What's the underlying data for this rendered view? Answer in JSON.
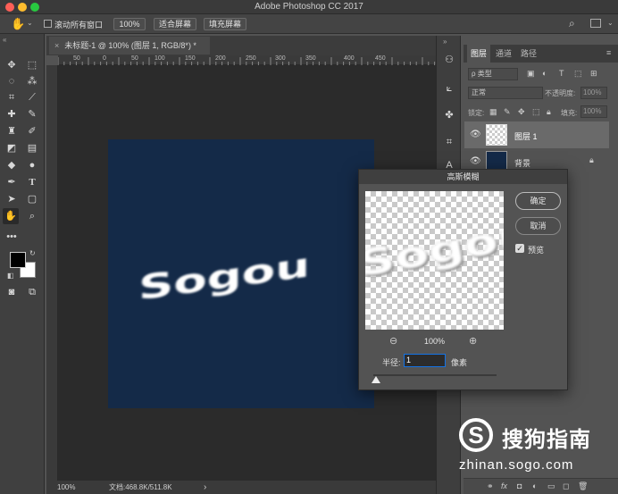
{
  "app": {
    "title": "Adobe Photoshop CC 2017"
  },
  "options_bar": {
    "scroll_all_label": "滚动所有窗口",
    "zoom_label": "100%",
    "fit_screen_label": "适合屏幕",
    "fill_screen_label": "填充屏幕"
  },
  "document": {
    "tab_label": "未标题-1 @ 100% (图层 1, RGB/8*) *",
    "ruler_ticks": [
      "50",
      "0",
      "50",
      "100",
      "150",
      "200",
      "250",
      "300",
      "350",
      "400",
      "450"
    ],
    "canvas_text": "Sogou",
    "canvas_color": "#142a48"
  },
  "status_bar": {
    "zoom": "100%",
    "doc_info": "文档:468.8K/511.8K",
    "arrow": "›"
  },
  "layers_panel": {
    "tabs": [
      "图层",
      "通道",
      "路径"
    ],
    "filter_label": "ρ 类型",
    "blend_mode": "正常",
    "opacity_label": "不透明度:",
    "opacity_value": "100%",
    "lock_label": "锁定:",
    "fill_label": "填充:",
    "fill_value": "100%",
    "layers": [
      {
        "name": "图层 1",
        "selected": true
      },
      {
        "name": "背景",
        "selected": false
      }
    ]
  },
  "gaussian_blur_dialog": {
    "title": "高斯模糊",
    "ok_label": "确定",
    "cancel_label": "取消",
    "preview_label": "预览",
    "preview_checked": true,
    "zoom_value": "100%",
    "radius_label": "半径:",
    "radius_value": "1",
    "radius_unit": "像素",
    "preview_text": "Sogou"
  },
  "watermark": {
    "brand": "搜狗指南",
    "url": "zhinan.sogo.com"
  },
  "colors": {
    "foreground": "#000000",
    "background": "#ffffff",
    "accent": "#1473e6"
  }
}
